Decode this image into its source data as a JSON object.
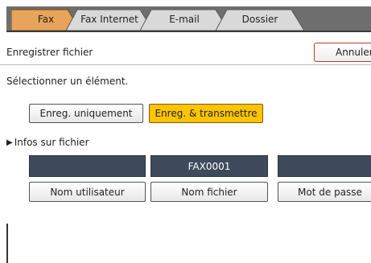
{
  "tabs": [
    {
      "label": "Fax",
      "active": true
    },
    {
      "label": "Fax Internet",
      "active": false
    },
    {
      "label": "E-mail",
      "active": false
    },
    {
      "label": "Dossier",
      "active": false
    }
  ],
  "header": {
    "title": "Enregistrer fichier",
    "cancel_label": "Annuler"
  },
  "instruction": "Sélectionner un élément.",
  "options": [
    {
      "label": "Enreg. uniquement",
      "selected": false
    },
    {
      "label": "Enreg. & transmettre",
      "selected": true
    }
  ],
  "file_info": {
    "section_label": "Infos sur fichier",
    "fields": [
      {
        "value": "",
        "button_label": "Nom utilisateur"
      },
      {
        "value": "FAX0001",
        "button_label": "Nom fichier"
      },
      {
        "value": "",
        "button_label": "Mot de passe"
      }
    ]
  },
  "colors": {
    "accent": "#ffc400",
    "active_tab": "#e8a45a",
    "field_bg": "#3e4a5c"
  }
}
